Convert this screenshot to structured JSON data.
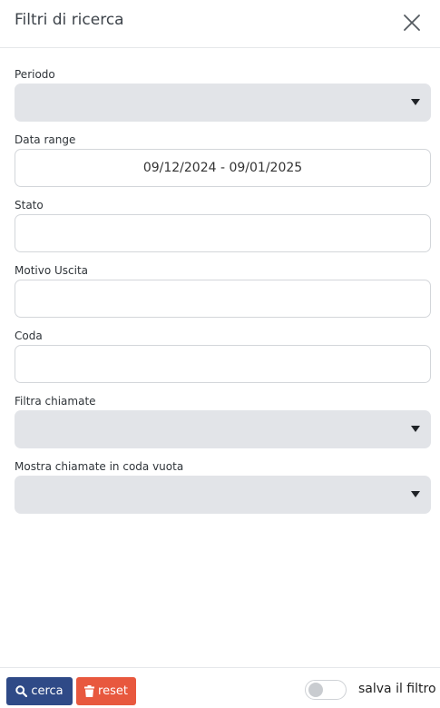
{
  "header": {
    "title": "Filtri di ricerca",
    "close_icon": "close-icon"
  },
  "form": {
    "periodo": {
      "label": "Periodo",
      "value": ""
    },
    "data_range": {
      "label": "Data range",
      "value": "09/12/2024 - 09/01/2025"
    },
    "stato": {
      "label": "Stato",
      "value": ""
    },
    "motivo_uscita": {
      "label": "Motivo Uscita",
      "value": ""
    },
    "coda": {
      "label": "Coda",
      "value": ""
    },
    "filtra_chiamate": {
      "label": "Filtra chiamate",
      "value": ""
    },
    "mostra_chiamate": {
      "label": "Mostra chiamate in coda vuota",
      "value": ""
    }
  },
  "footer": {
    "search_label": "cerca",
    "reset_label": "reset",
    "save_toggle_label": "salva il filtro",
    "save_toggle_on": false,
    "colors": {
      "search": "#2f4a87",
      "reset": "#e8583e"
    }
  }
}
